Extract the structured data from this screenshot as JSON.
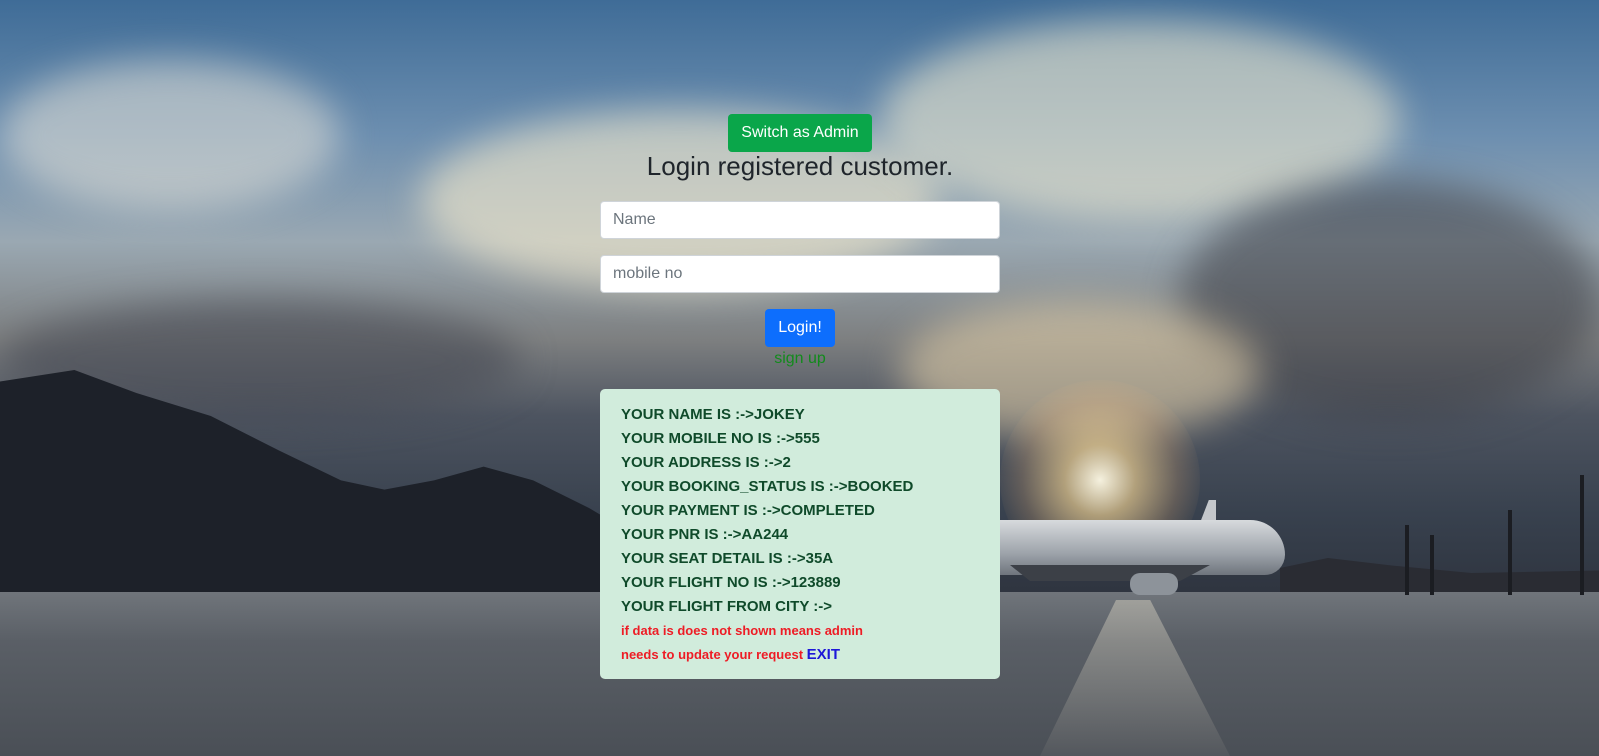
{
  "admin_switch": {
    "label": "Switch as Admin"
  },
  "login": {
    "title": "Login registered customer.",
    "name_placeholder": "Name",
    "mobile_placeholder": "mobile no",
    "submit_label": "Login!",
    "signup_label": "sign up"
  },
  "customer_info": {
    "lines": [
      "YOUR NAME IS :->JOKEY",
      "YOUR MOBILE NO IS :->555",
      "YOUR ADDRESS IS :->2",
      "YOUR BOOKING_STATUS IS :->BOOKED",
      "YOUR PAYMENT IS :->COMPLETED",
      "YOUR PNR IS :->AA244",
      "YOUR SEAT DETAIL IS :->35A",
      "YOUR FLIGHT NO IS :->123889",
      "YOUR FLIGHT FROM CITY :->"
    ],
    "note_line1": "if data is does not shown means admin",
    "note_line2": "needs to update your request",
    "exit_label": "EXIT"
  },
  "colors": {
    "admin_button": "#0aa64a",
    "login_button": "#0d6efd",
    "signup_link": "#128a1c",
    "panel_background": "#d1ecdc",
    "panel_text": "#0f4a2a",
    "note_text": "#ee1c25",
    "exit_link": "#1d17d8"
  }
}
